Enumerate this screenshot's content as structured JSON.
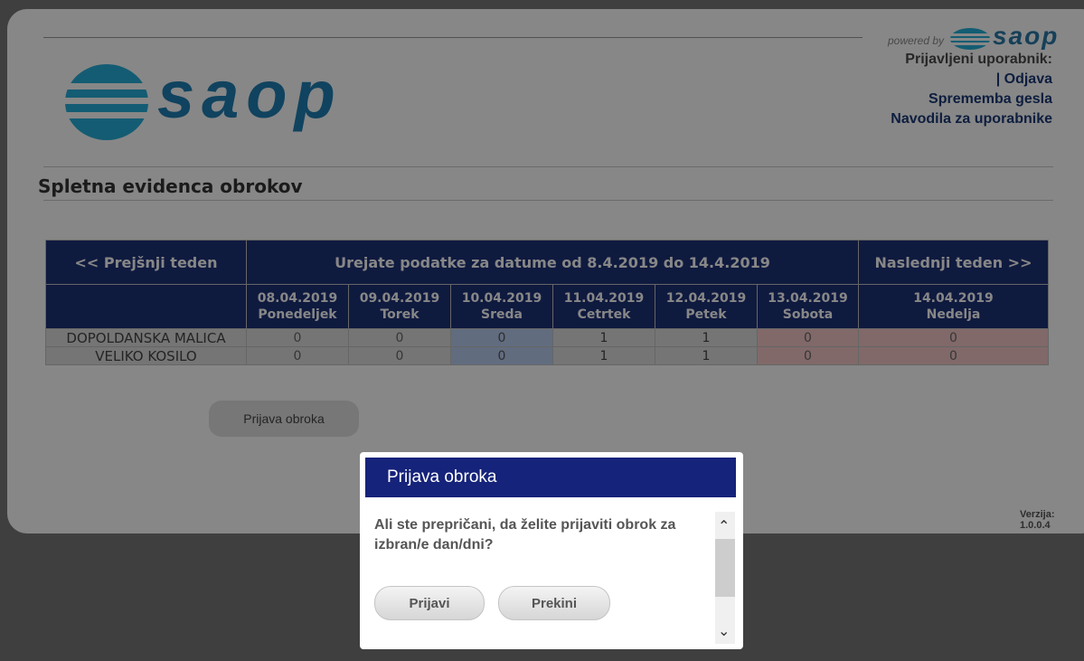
{
  "header": {
    "powered_by": "powered by",
    "brand": "saop",
    "logo_word": "saop",
    "user_label": "Prijavljeni uporabnik:",
    "logout": "| Odjava",
    "change_password": "Sprememba gesla",
    "user_guide": "Navodila za uporabnike"
  },
  "page": {
    "title": "Spletna evidenca obrokov",
    "prev_week": "<< Prejšnji teden",
    "date_range": "Urejate podatke za datume od 8.4.2019 do 14.4.2019",
    "next_week": "Naslednji teden >>",
    "register_button": "Prijava obroka",
    "version": "Verzija: 1.0.0.4"
  },
  "table": {
    "days": [
      {
        "date": "08.04.2019",
        "name": "Ponedeljek"
      },
      {
        "date": "09.04.2019",
        "name": "Torek"
      },
      {
        "date": "10.04.2019",
        "name": "Sreda"
      },
      {
        "date": "11.04.2019",
        "name": "Cetrtek"
      },
      {
        "date": "12.04.2019",
        "name": "Petek"
      },
      {
        "date": "13.04.2019",
        "name": "Sobota"
      },
      {
        "date": "14.04.2019",
        "name": "Nedelja"
      }
    ],
    "rows": [
      {
        "meal": "DOPOLDANSKA MALICA",
        "values": [
          "0",
          "0",
          "0",
          "1",
          "1",
          "0",
          "0"
        ]
      },
      {
        "meal": "VELIKO KOSILO",
        "values": [
          "0",
          "0",
          "0",
          "1",
          "1",
          "0",
          "0"
        ]
      }
    ]
  },
  "dialog": {
    "title": "Prijava obroka",
    "message": "Ali ste prepričani, da želite prijaviti obrok za izbran/e dan/dni?",
    "confirm": "Prijavi",
    "cancel": "Prekini"
  },
  "colors": {
    "nav_blue": "#1d3278",
    "dialog_title": "#16237a",
    "today_cell": "#b7cdf0",
    "weekend_cell": "#f4c6c6"
  }
}
